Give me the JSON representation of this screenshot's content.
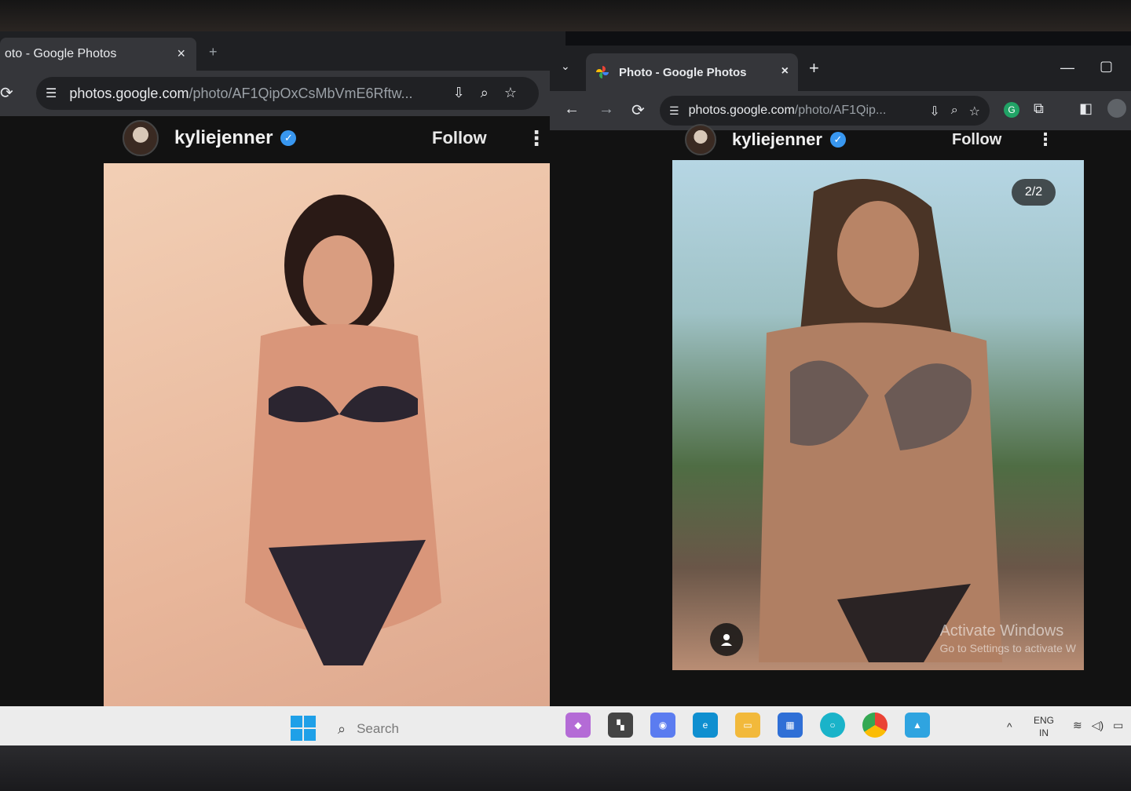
{
  "left_window": {
    "tab_title": "oto - Google Photos",
    "tab_close": "×",
    "new_tab": "+",
    "url_domain": "photos.google.com",
    "url_path": "/photo/AF1QipOxCsMbVmE6Rftw...",
    "post": {
      "username": "kyliejenner",
      "follow_label": "Follow",
      "more_label": "⋮"
    }
  },
  "right_window": {
    "tab_title": "Photo - Google Photos",
    "tab_close": "×",
    "new_tab": "+",
    "url_domain": "photos.google.com",
    "url_path": "/photo/AF1Qip...",
    "post": {
      "username": "kyliejenner",
      "follow_label": "Follow",
      "more_label": "⋮",
      "counter": "2/2"
    },
    "watermark": {
      "line1": "Activate Windows",
      "line2": "Go to Settings to activate W"
    }
  },
  "taskbar": {
    "search_placeholder": "Search",
    "lang_line1": "ENG",
    "lang_line2": "IN"
  },
  "colors": {
    "verified": "#3897f0",
    "chrome_dark": "#202124",
    "tab_active": "#35363a",
    "taskbar": "#ececec",
    "windows_blue": "#1fa0e8"
  },
  "icons": {
    "reload": "reload-icon",
    "back": "back-arrow-icon",
    "forward": "forward-arrow-icon",
    "site_settings": "site-settings-icon",
    "install": "install-app-icon",
    "zoom": "zoom-icon",
    "bookmark": "star-icon",
    "extensions": "puzzle-icon"
  }
}
